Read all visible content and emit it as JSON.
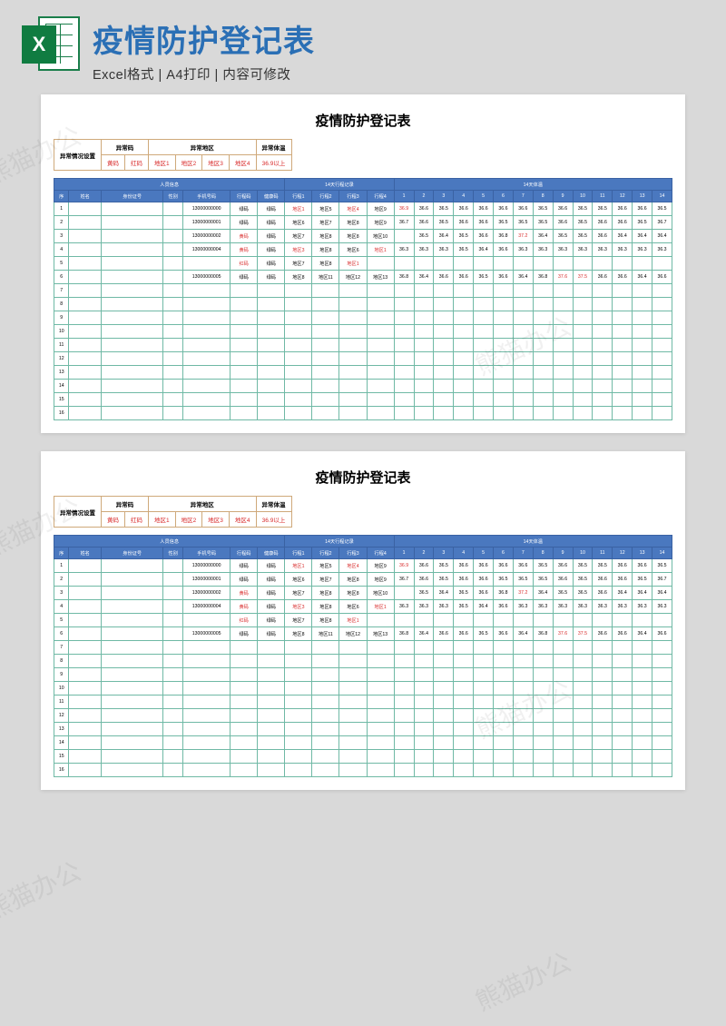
{
  "banner": {
    "title": "疫情防护登记表",
    "subtitle": "Excel格式 | A4打印 | 内容可修改",
    "icon_letter": "X"
  },
  "doc_title": "疫情防护登记表",
  "settings": {
    "label": "异常情况设置",
    "groups": [
      {
        "label": "异常码",
        "items": [
          "黄码",
          "红码"
        ]
      },
      {
        "label": "异常地区",
        "items": [
          "地区1",
          "地区2",
          "地区3",
          "地区4"
        ]
      },
      {
        "label": "异常体温",
        "items": [
          "36.9以上"
        ]
      }
    ]
  },
  "headers": {
    "group_person": "人员信息",
    "group_trip": "14天行程记录",
    "group_temp": "14天体温",
    "seq": "序",
    "name": "姓名",
    "id": "身份证号",
    "sex": "性别",
    "phone": "手机号码",
    "code": "行程码",
    "hcode": "健康码",
    "trips": [
      "行程1",
      "行程2",
      "行程3",
      "行程4"
    ],
    "days": [
      "1",
      "2",
      "3",
      "4",
      "5",
      "6",
      "7",
      "8",
      "9",
      "10",
      "11",
      "12",
      "13",
      "14"
    ]
  },
  "chart_data": {
    "type": "table",
    "abnormal_codes": [
      "黄码",
      "红码"
    ],
    "abnormal_regions": [
      "地区1",
      "地区2",
      "地区3",
      "地区4"
    ],
    "abnormal_temp_threshold": 36.9,
    "rows": [
      {
        "seq": 1,
        "name": "",
        "id": "",
        "sex": "",
        "phone": "13000000000",
        "code": "绿码",
        "hcode": "绿码",
        "trips": [
          "地区1",
          "地区5",
          "地区4",
          "地区9"
        ],
        "temps": [
          36.9,
          36.6,
          36.5,
          36.6,
          36.6,
          36.6,
          36.6,
          36.5,
          36.6,
          36.5,
          36.5,
          36.6,
          36.6,
          36.5
        ]
      },
      {
        "seq": 2,
        "name": "",
        "id": "",
        "sex": "",
        "phone": "13000000001",
        "code": "绿码",
        "hcode": "绿码",
        "trips": [
          "地区6",
          "地区7",
          "地区8",
          "地区9"
        ],
        "temps": [
          36.7,
          36.6,
          36.5,
          36.6,
          36.6,
          36.5,
          36.5,
          36.5,
          36.6,
          36.5,
          36.6,
          36.6,
          36.5,
          36.7
        ]
      },
      {
        "seq": 3,
        "name": "",
        "id": "",
        "sex": "",
        "phone": "13000000002",
        "code": "黄码",
        "hcode": "绿码",
        "trips": [
          "地区7",
          "地区8",
          "地区8",
          "地区10"
        ],
        "temps": [
          null,
          36.5,
          36.4,
          36.5,
          36.6,
          36.8,
          37.2,
          36.4,
          36.5,
          36.5,
          36.6,
          36.4,
          36.4,
          36.4
        ]
      },
      {
        "seq": 4,
        "name": "",
        "id": "",
        "sex": "",
        "phone": "13000000004",
        "code": "黄码",
        "hcode": "绿码",
        "trips": [
          "地区3",
          "地区8",
          "地区6",
          "地区1"
        ],
        "temps": [
          36.3,
          36.3,
          36.3,
          36.5,
          36.4,
          36.6,
          36.3,
          36.3,
          36.3,
          36.3,
          36.3,
          36.3,
          36.3,
          36.3
        ]
      },
      {
        "seq": 5,
        "name": "",
        "id": "",
        "sex": "",
        "phone": "",
        "code": "红码",
        "hcode": "绿码",
        "trips": [
          "地区7",
          "地区8",
          "地区1",
          ""
        ],
        "temps": [
          null,
          null,
          null,
          null,
          null,
          null,
          null,
          null,
          null,
          null,
          null,
          null,
          null,
          null
        ]
      },
      {
        "seq": 6,
        "name": "",
        "id": "",
        "sex": "",
        "phone": "13000000005",
        "code": "绿码",
        "hcode": "绿码",
        "trips": [
          "地区8",
          "地区11",
          "地区12",
          "地区13"
        ],
        "temps": [
          36.8,
          36.4,
          36.6,
          36.6,
          36.5,
          36.6,
          36.4,
          36.8,
          37.6,
          37.5,
          36.6,
          36.6,
          36.4,
          36.6
        ]
      }
    ],
    "empty_rows": [
      7,
      8,
      9,
      10,
      11,
      12,
      13,
      14,
      15,
      16
    ]
  },
  "watermarks": [
    "熊猫办公",
    "熊猫办公",
    "熊猫办公",
    "熊猫办公",
    "熊猫办公",
    "熊猫办公"
  ]
}
